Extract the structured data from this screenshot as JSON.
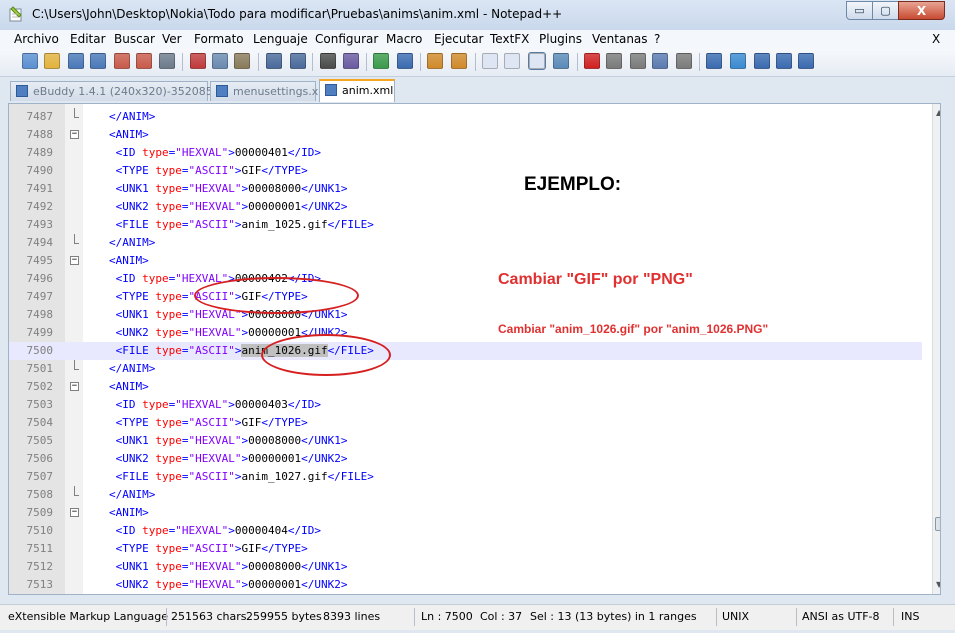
{
  "window": {
    "title": "C:\\Users\\John\\Desktop\\Nokia\\Todo para modificar\\Pruebas\\anims\\anim.xml - Notepad++",
    "min_glyph": "▭",
    "max_glyph": "▢",
    "close_glyph": "X"
  },
  "menu": {
    "items": [
      "Archivo",
      "Editar",
      "Buscar",
      "Ver",
      "Formato",
      "Lenguaje",
      "Configurar",
      "Macro",
      "Ejecutar",
      "TextFX",
      "Plugins",
      "Ventanas",
      "?"
    ],
    "close_doc": "X"
  },
  "toolbar": {
    "icons": [
      "new-file-icon",
      "open-file-icon",
      "save-icon",
      "save-all-icon",
      "close-icon",
      "close-all-icon",
      "print-icon",
      "cut-icon",
      "copy-icon",
      "paste-icon",
      "undo-icon",
      "redo-icon",
      "find-icon",
      "replace-icon",
      "zoom-in-icon",
      "zoom-out-icon",
      "sync-vertical-icon",
      "sync-horizontal-icon",
      "word-wrap-icon",
      "show-all-chars-icon",
      "indent-guide-icon",
      "user-lang-icon",
      "record-macro-icon",
      "stop-macro-icon",
      "play-macro-icon",
      "run-macro-multiple-icon",
      "save-macro-icon",
      "textfx-1-icon",
      "textfx-2-icon",
      "textfx-3-icon",
      "textfx-4-icon",
      "spellcheck-icon"
    ]
  },
  "tabs": [
    {
      "label": "eBuddy 1.4.1 (240x320)-352085.jad",
      "active": false
    },
    {
      "label": "menusettings.xml",
      "active": false
    },
    {
      "label": "anim.xml",
      "active": true
    }
  ],
  "editor": {
    "current_line": 7500,
    "lines": [
      {
        "n": "7487",
        "indent": "    ",
        "parts": [
          [
            "tag",
            "</ANIM>"
          ]
        ],
        "fold": "end"
      },
      {
        "n": "7488",
        "indent": "    ",
        "parts": [
          [
            "tag",
            "<ANIM>"
          ]
        ],
        "fold": "open"
      },
      {
        "n": "7489",
        "indent": "     ",
        "parts": [
          [
            "tag",
            "<ID "
          ],
          [
            "attr",
            "type"
          ],
          [
            "tag",
            "="
          ],
          [
            "val",
            "\"HEXVAL\""
          ],
          [
            "tag",
            ">"
          ],
          [
            "txt",
            "00000401"
          ],
          [
            "tag",
            "</ID>"
          ]
        ]
      },
      {
        "n": "7490",
        "indent": "     ",
        "parts": [
          [
            "tag",
            "<TYPE "
          ],
          [
            "attr",
            "type"
          ],
          [
            "tag",
            "="
          ],
          [
            "val",
            "\"ASCII\""
          ],
          [
            "tag",
            ">"
          ],
          [
            "txt",
            "GIF"
          ],
          [
            "tag",
            "</TYPE>"
          ]
        ]
      },
      {
        "n": "7491",
        "indent": "     ",
        "parts": [
          [
            "tag",
            "<UNK1 "
          ],
          [
            "attr",
            "type"
          ],
          [
            "tag",
            "="
          ],
          [
            "val",
            "\"HEXVAL\""
          ],
          [
            "tag",
            ">"
          ],
          [
            "txt",
            "00008000"
          ],
          [
            "tag",
            "</UNK1>"
          ]
        ]
      },
      {
        "n": "7492",
        "indent": "     ",
        "parts": [
          [
            "tag",
            "<UNK2 "
          ],
          [
            "attr",
            "type"
          ],
          [
            "tag",
            "="
          ],
          [
            "val",
            "\"HEXVAL\""
          ],
          [
            "tag",
            ">"
          ],
          [
            "txt",
            "00000001"
          ],
          [
            "tag",
            "</UNK2>"
          ]
        ]
      },
      {
        "n": "7493",
        "indent": "     ",
        "parts": [
          [
            "tag",
            "<FILE "
          ],
          [
            "attr",
            "type"
          ],
          [
            "tag",
            "="
          ],
          [
            "val",
            "\"ASCII\""
          ],
          [
            "tag",
            ">"
          ],
          [
            "txt",
            "anim_1025.gif"
          ],
          [
            "tag",
            "</FILE>"
          ]
        ]
      },
      {
        "n": "7494",
        "indent": "    ",
        "parts": [
          [
            "tag",
            "</ANIM>"
          ]
        ],
        "fold": "end"
      },
      {
        "n": "7495",
        "indent": "    ",
        "parts": [
          [
            "tag",
            "<ANIM>"
          ]
        ],
        "fold": "open"
      },
      {
        "n": "7496",
        "indent": "     ",
        "parts": [
          [
            "tag",
            "<ID "
          ],
          [
            "attr",
            "type"
          ],
          [
            "tag",
            "="
          ],
          [
            "val",
            "\"HEXVAL\""
          ],
          [
            "tag",
            ">"
          ],
          [
            "txt",
            "00000402"
          ],
          [
            "tag",
            "</ID>"
          ]
        ]
      },
      {
        "n": "7497",
        "indent": "     ",
        "parts": [
          [
            "tag",
            "<TYPE "
          ],
          [
            "attr",
            "type"
          ],
          [
            "tag",
            "="
          ],
          [
            "val",
            "\"ASCII\""
          ],
          [
            "tag",
            ">"
          ],
          [
            "txt",
            "GIF"
          ],
          [
            "tag",
            "</TYPE>"
          ]
        ]
      },
      {
        "n": "7498",
        "indent": "     ",
        "parts": [
          [
            "tag",
            "<UNK1 "
          ],
          [
            "attr",
            "type"
          ],
          [
            "tag",
            "="
          ],
          [
            "val",
            "\"HEXVAL\""
          ],
          [
            "tag",
            ">"
          ],
          [
            "txt",
            "00008000"
          ],
          [
            "tag",
            "</UNK1>"
          ]
        ]
      },
      {
        "n": "7499",
        "indent": "     ",
        "parts": [
          [
            "tag",
            "<UNK2 "
          ],
          [
            "attr",
            "type"
          ],
          [
            "tag",
            "="
          ],
          [
            "val",
            "\"HEXVAL\""
          ],
          [
            "tag",
            ">"
          ],
          [
            "txt",
            "00000001"
          ],
          [
            "tag",
            "</UNK2>"
          ]
        ]
      },
      {
        "n": "7500",
        "indent": "     ",
        "parts": [
          [
            "tag",
            "<FILE "
          ],
          [
            "attr",
            "type"
          ],
          [
            "tag",
            "="
          ],
          [
            "val",
            "\"ASCII\""
          ],
          [
            "tag",
            ">"
          ],
          [
            "sel",
            "anim_1026.gif"
          ],
          [
            "tag",
            "</FILE>"
          ]
        ]
      },
      {
        "n": "7501",
        "indent": "    ",
        "parts": [
          [
            "tag",
            "</ANIM>"
          ]
        ],
        "fold": "end"
      },
      {
        "n": "7502",
        "indent": "    ",
        "parts": [
          [
            "tag",
            "<ANIM>"
          ]
        ],
        "fold": "open"
      },
      {
        "n": "7503",
        "indent": "     ",
        "parts": [
          [
            "tag",
            "<ID "
          ],
          [
            "attr",
            "type"
          ],
          [
            "tag",
            "="
          ],
          [
            "val",
            "\"HEXVAL\""
          ],
          [
            "tag",
            ">"
          ],
          [
            "txt",
            "00000403"
          ],
          [
            "tag",
            "</ID>"
          ]
        ]
      },
      {
        "n": "7504",
        "indent": "     ",
        "parts": [
          [
            "tag",
            "<TYPE "
          ],
          [
            "attr",
            "type"
          ],
          [
            "tag",
            "="
          ],
          [
            "val",
            "\"ASCII\""
          ],
          [
            "tag",
            ">"
          ],
          [
            "txt",
            "GIF"
          ],
          [
            "tag",
            "</TYPE>"
          ]
        ]
      },
      {
        "n": "7505",
        "indent": "     ",
        "parts": [
          [
            "tag",
            "<UNK1 "
          ],
          [
            "attr",
            "type"
          ],
          [
            "tag",
            "="
          ],
          [
            "val",
            "\"HEXVAL\""
          ],
          [
            "tag",
            ">"
          ],
          [
            "txt",
            "00008000"
          ],
          [
            "tag",
            "</UNK1>"
          ]
        ]
      },
      {
        "n": "7506",
        "indent": "     ",
        "parts": [
          [
            "tag",
            "<UNK2 "
          ],
          [
            "attr",
            "type"
          ],
          [
            "tag",
            "="
          ],
          [
            "val",
            "\"HEXVAL\""
          ],
          [
            "tag",
            ">"
          ],
          [
            "txt",
            "00000001"
          ],
          [
            "tag",
            "</UNK2>"
          ]
        ]
      },
      {
        "n": "7507",
        "indent": "     ",
        "parts": [
          [
            "tag",
            "<FILE "
          ],
          [
            "attr",
            "type"
          ],
          [
            "tag",
            "="
          ],
          [
            "val",
            "\"ASCII\""
          ],
          [
            "tag",
            ">"
          ],
          [
            "txt",
            "anim_1027.gif"
          ],
          [
            "tag",
            "</FILE>"
          ]
        ]
      },
      {
        "n": "7508",
        "indent": "    ",
        "parts": [
          [
            "tag",
            "</ANIM>"
          ]
        ],
        "fold": "end"
      },
      {
        "n": "7509",
        "indent": "    ",
        "parts": [
          [
            "tag",
            "<ANIM>"
          ]
        ],
        "fold": "open"
      },
      {
        "n": "7510",
        "indent": "     ",
        "parts": [
          [
            "tag",
            "<ID "
          ],
          [
            "attr",
            "type"
          ],
          [
            "tag",
            "="
          ],
          [
            "val",
            "\"HEXVAL\""
          ],
          [
            "tag",
            ">"
          ],
          [
            "txt",
            "00000404"
          ],
          [
            "tag",
            "</ID>"
          ]
        ]
      },
      {
        "n": "7511",
        "indent": "     ",
        "parts": [
          [
            "tag",
            "<TYPE "
          ],
          [
            "attr",
            "type"
          ],
          [
            "tag",
            "="
          ],
          [
            "val",
            "\"ASCII\""
          ],
          [
            "tag",
            ">"
          ],
          [
            "txt",
            "GIF"
          ],
          [
            "tag",
            "</TYPE>"
          ]
        ]
      },
      {
        "n": "7512",
        "indent": "     ",
        "parts": [
          [
            "tag",
            "<UNK1 "
          ],
          [
            "attr",
            "type"
          ],
          [
            "tag",
            "="
          ],
          [
            "val",
            "\"HEXVAL\""
          ],
          [
            "tag",
            ">"
          ],
          [
            "txt",
            "00008000"
          ],
          [
            "tag",
            "</UNK1>"
          ]
        ]
      },
      {
        "n": "7513",
        "indent": "     ",
        "parts": [
          [
            "tag",
            "<UNK2 "
          ],
          [
            "attr",
            "type"
          ],
          [
            "tag",
            "="
          ],
          [
            "val",
            "\"HEXVAL\""
          ],
          [
            "tag",
            ">"
          ],
          [
            "txt",
            "00000001"
          ],
          [
            "tag",
            "</UNK2>"
          ]
        ]
      }
    ]
  },
  "annotations": {
    "heading": "EJEMPLO:",
    "change_type": "Cambiar \"GIF\" por \"PNG\"",
    "change_file": "Cambiar \"anim_1026.gif\" por \"anim_1026.PNG\"",
    "color": "#e03030"
  },
  "statusbar": {
    "language": "eXtensible Markup Language",
    "chars": "251563 chars",
    "bytes": "259955 bytes",
    "lines": "8393 lines",
    "ln": "Ln : 7500",
    "col": "Col : 37",
    "sel": "Sel : 13 (13 bytes) in 1 ranges",
    "eol": "UNIX",
    "encoding": "ANSI as UTF-8",
    "mode": "INS"
  }
}
